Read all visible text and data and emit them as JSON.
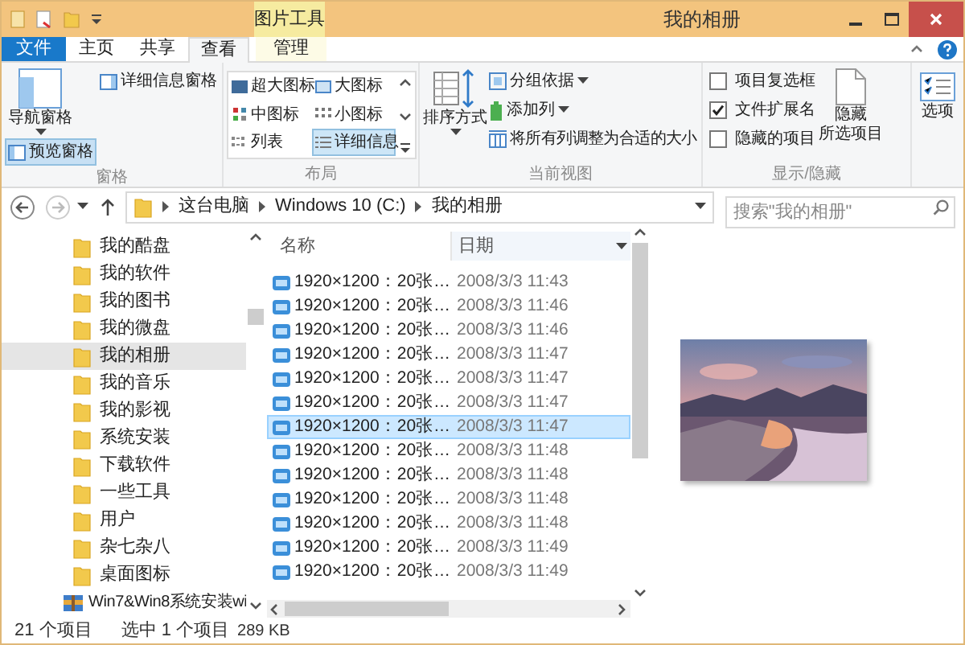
{
  "title_bar": {
    "context_tab": "图片工具",
    "title": "我的相册"
  },
  "ribbon_tabs": [
    {
      "label": "文件",
      "kind": "file",
      "selected": false
    },
    {
      "label": "主页",
      "kind": "tab",
      "selected": false
    },
    {
      "label": "共享",
      "kind": "tab",
      "selected": false
    },
    {
      "label": "查看",
      "kind": "tab",
      "selected": true
    },
    {
      "label": "管理",
      "kind": "context",
      "selected": false
    }
  ],
  "panes_group": {
    "label": "窗格",
    "navigation_pane": "导航窗格",
    "preview_pane": {
      "label": "预览窗格",
      "selected": true
    },
    "details_pane": {
      "label": "详细信息窗格",
      "selected": false
    }
  },
  "layout_group": {
    "label": "布局",
    "options": [
      {
        "label": "超大图标",
        "selected": false
      },
      {
        "label": "大图标",
        "selected": false
      },
      {
        "label": "中图标",
        "selected": false
      },
      {
        "label": "小图标",
        "selected": false
      },
      {
        "label": "列表",
        "selected": false
      },
      {
        "label": "详细信息",
        "selected": true
      }
    ]
  },
  "current_view_group": {
    "label": "当前视图",
    "sort_by": "排序方式",
    "group_by": "分组依据",
    "add_columns": "添加列",
    "size_all_columns": "将所有列调整为合适的大小"
  },
  "show_hide_group": {
    "label": "显示/隐藏",
    "checkboxes": [
      {
        "label": "项目复选框",
        "checked": false
      },
      {
        "label": "文件扩展名",
        "checked": true
      },
      {
        "label": "隐藏的项目",
        "checked": false
      }
    ],
    "hide_selected": [
      "隐藏",
      "所选项目"
    ]
  },
  "options_button": "选项",
  "address_bar": {
    "breadcrumbs": [
      "这台电脑",
      "Windows 10 (C:)",
      "我的相册"
    ]
  },
  "search": {
    "placeholder": "搜索\"我的相册\""
  },
  "nav_pane": {
    "items": [
      {
        "label": "我的酷盘",
        "kind": "folder",
        "selected": false
      },
      {
        "label": "我的软件",
        "kind": "folder",
        "selected": false
      },
      {
        "label": "我的图书",
        "kind": "folder",
        "selected": false
      },
      {
        "label": "我的微盘",
        "kind": "folder",
        "selected": false
      },
      {
        "label": "我的相册",
        "kind": "folder",
        "selected": true
      },
      {
        "label": "我的音乐",
        "kind": "folder",
        "selected": false
      },
      {
        "label": "我的影视",
        "kind": "folder",
        "selected": false
      },
      {
        "label": "系统安装",
        "kind": "folder",
        "selected": false
      },
      {
        "label": "下载软件",
        "kind": "folder",
        "selected": false
      },
      {
        "label": "一些工具",
        "kind": "folder",
        "selected": false
      },
      {
        "label": "用户",
        "kind": "folder",
        "selected": false
      },
      {
        "label": "杂七杂八",
        "kind": "folder",
        "selected": false
      },
      {
        "label": "桌面图标",
        "kind": "folder",
        "selected": false
      },
      {
        "label": "Win7&Win8系统安装wi",
        "kind": "archive",
        "selected": false
      }
    ]
  },
  "file_list": {
    "columns": [
      "名称",
      "日期"
    ],
    "rows": [
      {
        "name": "1920×1200：20张…",
        "date": "2008/3/3 11:43",
        "selected": false
      },
      {
        "name": "1920×1200：20张…",
        "date": "2008/3/3 11:46",
        "selected": false
      },
      {
        "name": "1920×1200：20张…",
        "date": "2008/3/3 11:46",
        "selected": false
      },
      {
        "name": "1920×1200：20张…",
        "date": "2008/3/3 11:47",
        "selected": false
      },
      {
        "name": "1920×1200：20张…",
        "date": "2008/3/3 11:47",
        "selected": false
      },
      {
        "name": "1920×1200：20张…",
        "date": "2008/3/3 11:47",
        "selected": false
      },
      {
        "name": "1920×1200：20张…",
        "date": "2008/3/3 11:47",
        "selected": true
      },
      {
        "name": "1920×1200：20张…",
        "date": "2008/3/3 11:48",
        "selected": false
      },
      {
        "name": "1920×1200：20张…",
        "date": "2008/3/3 11:48",
        "selected": false
      },
      {
        "name": "1920×1200：20张…",
        "date": "2008/3/3 11:48",
        "selected": false
      },
      {
        "name": "1920×1200：20张…",
        "date": "2008/3/3 11:48",
        "selected": false
      },
      {
        "name": "1920×1200：20张…",
        "date": "2008/3/3 11:49",
        "selected": false
      },
      {
        "name": "1920×1200：20张…",
        "date": "2008/3/3 11:49",
        "selected": false
      }
    ]
  },
  "status_bar": {
    "item_count": "21 个项目",
    "selection": "选中 1 个项目",
    "size": "289 KB"
  }
}
